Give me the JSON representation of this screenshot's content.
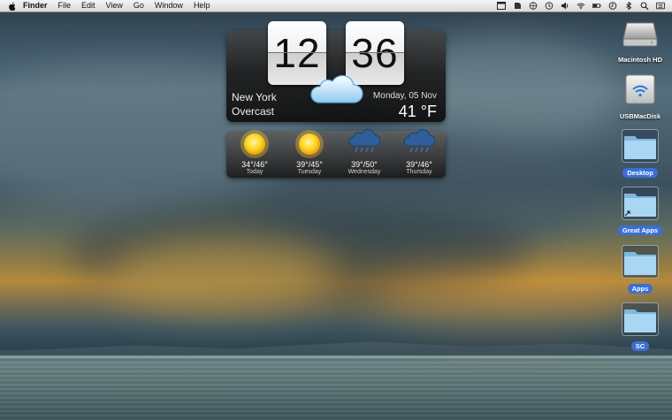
{
  "menubar": {
    "apple_icon": "apple-logo-icon",
    "items": [
      "Finder",
      "File",
      "Edit",
      "View",
      "Go",
      "Window",
      "Help"
    ],
    "status_icons": [
      "window-icon",
      "evernote-icon",
      "network-icon",
      "time-machine-icon",
      "volume-icon",
      "wifi-icon",
      "battery-icon",
      "clock-icon",
      "bluetooth-icon",
      "spotlight-icon",
      "notification-center-icon"
    ]
  },
  "clock_widget": {
    "hour": "12",
    "minute": "36",
    "city": "New York",
    "condition": "Overcast",
    "date": "Monday, 05 Nov",
    "temperature": "41 °F",
    "condition_icon": "cloud-icon"
  },
  "forecast": [
    {
      "temps": "34°/46°",
      "day": "Today",
      "icon": "sun-icon"
    },
    {
      "temps": "39°/45°",
      "day": "Tuesday",
      "icon": "sun-icon"
    },
    {
      "temps": "39°/50°",
      "day": "Wednesday",
      "icon": "rain-cloud-icon"
    },
    {
      "temps": "39°/46°",
      "day": "Thursday",
      "icon": "rain-cloud-icon"
    }
  ],
  "desktop_icons": [
    {
      "label": "Macintosh HD",
      "icon": "hard-drive-icon",
      "selected": false
    },
    {
      "label": "USBMacDisk",
      "icon": "usb-disk-icon",
      "selected": false
    },
    {
      "label": "Desktop",
      "icon": "folder-icon",
      "selected": true
    },
    {
      "label": "Great Apps",
      "icon": "folder-alias-icon",
      "selected": true
    },
    {
      "label": "Apps",
      "icon": "folder-icon",
      "selected": true
    },
    {
      "label": "SC",
      "icon": "folder-icon",
      "selected": true
    }
  ],
  "colors": {
    "selection_blue": "#3a6fd8",
    "folder_blue": "#8fc4e8",
    "sun_yellow": "#ffd21e"
  }
}
